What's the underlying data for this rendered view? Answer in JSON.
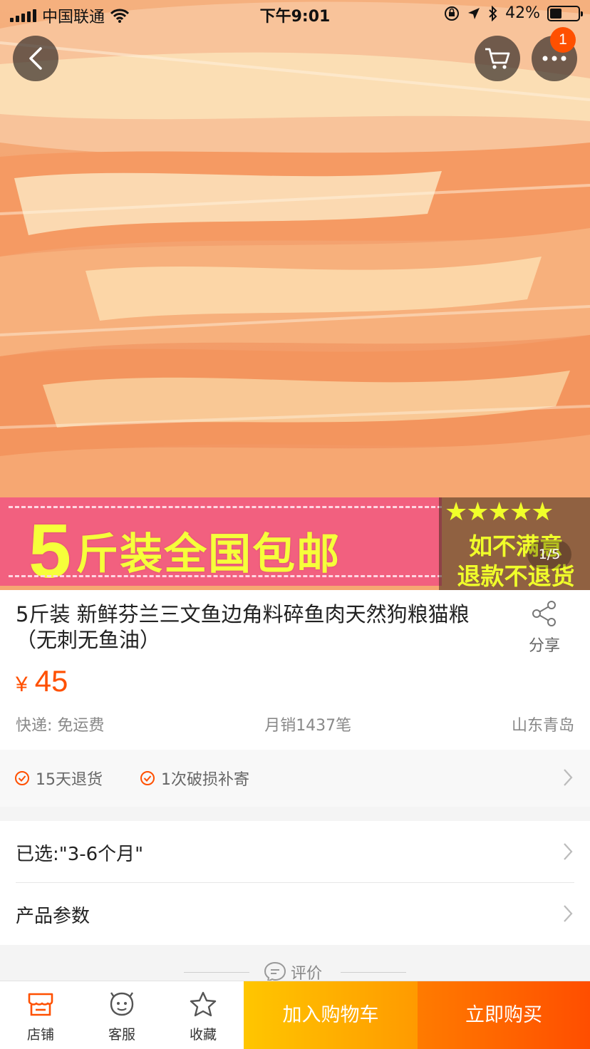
{
  "status_bar": {
    "carrier": "中国联通",
    "time": "下午9:01",
    "battery": "42%",
    "battery_level": 0.42
  },
  "gallery": {
    "cart_badge": "1",
    "pager": "1/5",
    "promo_number": "5",
    "promo_text": "斤装全国包邮",
    "stars": "★★★★★",
    "promo_line1": "如不满意",
    "promo_line2": "退款不退货"
  },
  "product": {
    "title": "5斤装 新鲜芬兰三文鱼边角料碎鱼肉天然狗粮猫粮（无刺无鱼油）",
    "share_label": "分享",
    "currency": "¥",
    "price": "45",
    "shipping": "快递: 免运费",
    "monthly_sales": "月销1437笔",
    "location": "山东青岛"
  },
  "guarantees": [
    "15天退货",
    "1次破损补寄"
  ],
  "options": {
    "selected": "已选:\"3-6个月\"",
    "params": "产品参数"
  },
  "reviews": {
    "label": "评价"
  },
  "bottom_bar": {
    "shop": "店铺",
    "service": "客服",
    "favorite": "收藏",
    "add_to_cart": "加入购物车",
    "buy_now": "立即购买"
  },
  "colors": {
    "accent": "#ff5000",
    "cart_button": "#ffb300",
    "buy_button": "#ff5a00"
  }
}
